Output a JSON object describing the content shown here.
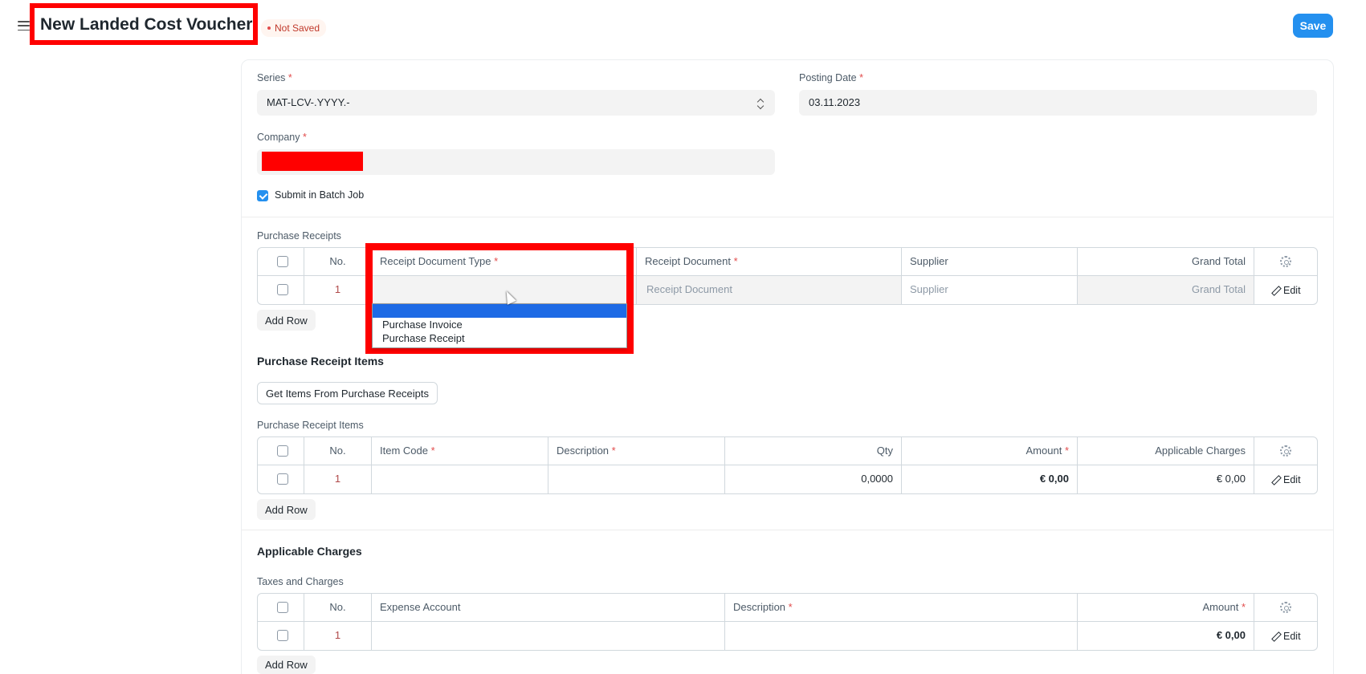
{
  "header": {
    "title": "New Landed Cost Voucher",
    "status": "Not Saved",
    "save_label": "Save"
  },
  "fields": {
    "series_label": "Series",
    "series_value": "MAT-LCV-.YYYY.-",
    "posting_date_label": "Posting Date",
    "posting_date_value": "03.11.2023",
    "company_label": "Company",
    "company_value": "",
    "batch_label": "Submit in Batch Job",
    "batch_checked": true,
    "required_mark": "*"
  },
  "receipts": {
    "label": "Purchase Receipts",
    "columns": [
      "No.",
      "Receipt Document Type",
      "Receipt Document",
      "Supplier",
      "Grand Total"
    ],
    "row": {
      "no": "1",
      "doc_type": "",
      "doc_placeholder": "Receipt Document",
      "supplier_placeholder": "Supplier",
      "grand_total_placeholder": "Grand Total"
    },
    "edit_label": "Edit",
    "add_row_label": "Add Row",
    "dropdown_options": [
      "",
      "Purchase Invoice",
      "Purchase Receipt"
    ]
  },
  "items_section": {
    "title": "Purchase Receipt Items",
    "get_items_label": "Get Items From Purchase Receipts",
    "table_label": "Purchase Receipt Items",
    "columns": [
      "No.",
      "Item Code",
      "Description",
      "Qty",
      "Amount",
      "Applicable Charges"
    ],
    "row": {
      "no": "1",
      "item_code": "",
      "description": "",
      "qty": "0,0000",
      "amount": "€ 0,00",
      "charges": "€ 0,00"
    },
    "edit_label": "Edit",
    "add_row_label": "Add Row"
  },
  "charges_section": {
    "title": "Applicable Charges",
    "table_label": "Taxes and Charges",
    "columns": [
      "No.",
      "Expense Account",
      "Description",
      "Amount"
    ],
    "row": {
      "no": "1",
      "expense_account": "",
      "description": "",
      "amount": "€ 0,00"
    },
    "edit_label": "Edit",
    "add_row_label": "Add Row"
  },
  "colors": {
    "primary": "#2490ef",
    "highlight_box": "#ff0000",
    "dropdown_selected": "#1d6ae5",
    "required": "#e24c4c"
  },
  "icons": [
    "hamburger-icon",
    "chevron-updown-icon",
    "gear-icon",
    "pencil-icon",
    "checkbox-icon",
    "mouse-cursor-icon"
  ]
}
